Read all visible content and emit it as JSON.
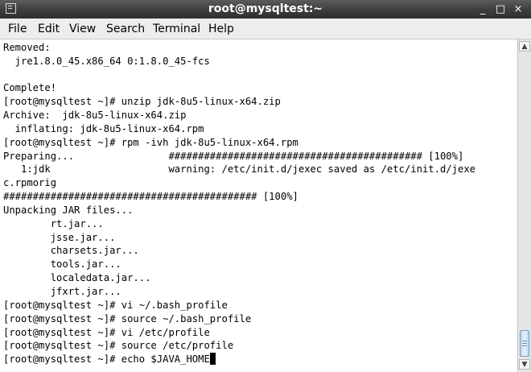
{
  "window": {
    "title": "root@mysqltest:~",
    "buttons": {
      "minimize": "_",
      "maximize": "□",
      "close": "×"
    }
  },
  "menu": {
    "items": [
      "File",
      "Edit",
      "View",
      "Search",
      "Terminal",
      "Help"
    ]
  },
  "terminal": {
    "lines": [
      "Removed:",
      "  jre1.8.0_45.x86_64 0:1.8.0_45-fcs",
      "",
      "Complete!",
      "[root@mysqltest ~]# unzip jdk-8u5-linux-x64.zip",
      "Archive:  jdk-8u5-linux-x64.zip",
      "  inflating: jdk-8u5-linux-x64.rpm",
      "[root@mysqltest ~]# rpm -ivh jdk-8u5-linux-x64.rpm",
      "Preparing...                ########################################### [100%]",
      "   1:jdk                    warning: /etc/init.d/jexec saved as /etc/init.d/jexe",
      "c.rpmorig",
      "########################################### [100%]",
      "Unpacking JAR files...",
      "        rt.jar...",
      "        jsse.jar...",
      "        charsets.jar...",
      "        tools.jar...",
      "        localedata.jar...",
      "        jfxrt.jar...",
      "[root@mysqltest ~]# vi ~/.bash_profile",
      "[root@mysqltest ~]# source ~/.bash_profile",
      "[root@mysqltest ~]# vi /etc/profile",
      "[root@mysqltest ~]# source /etc/profile",
      "[root@mysqltest ~]# echo $JAVA_HOME"
    ]
  },
  "scrollbar": {
    "up_arrow": "▲",
    "down_arrow": "▼",
    "position_fraction": 1.0
  },
  "icons": {
    "window_icon": "terminal-app-icon"
  }
}
